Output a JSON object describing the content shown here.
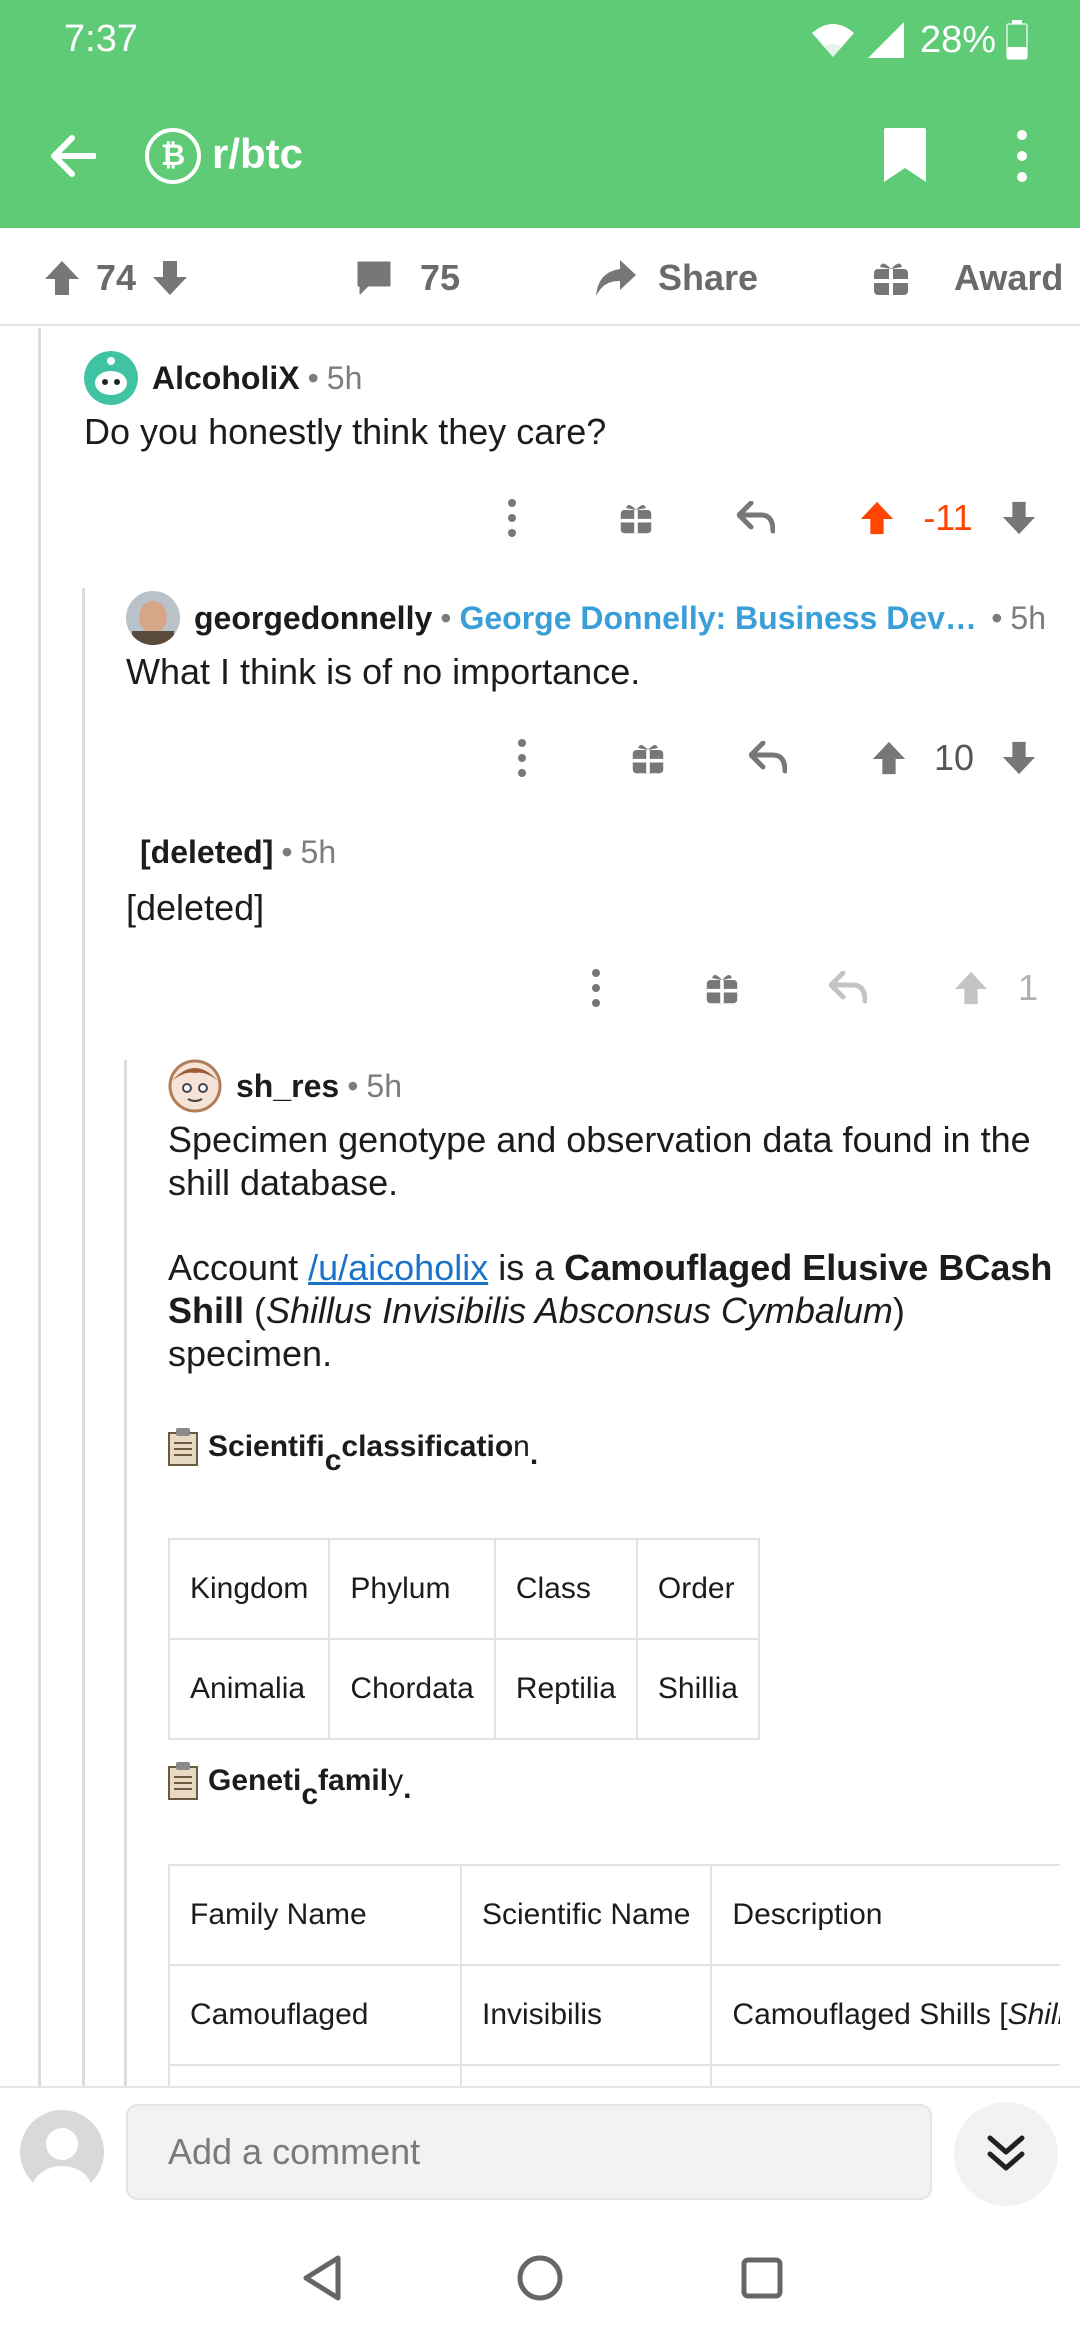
{
  "status": {
    "time": "7:37",
    "battery": "28%"
  },
  "header": {
    "subreddit": "r/btc",
    "sub_icon_glyph": "₿"
  },
  "post_bar": {
    "upvotes": "74",
    "comments": "75",
    "share": "Share",
    "award": "Award"
  },
  "comments": [
    {
      "user": "AlcoholiX",
      "time": "5h",
      "body": "Do you honestly think they care?",
      "score": "-11",
      "vote_state": "upvoted"
    },
    {
      "user": "georgedonnelly",
      "flair": "George Donnelly: Business Develop...",
      "time": "5h",
      "body": "What I think is of no importance.",
      "score": "10"
    },
    {
      "user": "[deleted]",
      "time": "5h",
      "body": "[deleted]",
      "score": "1"
    },
    {
      "user": "sh_res",
      "time": "5h",
      "para1": "Specimen genotype and observation data found in the shill database.",
      "para2": {
        "prefix": "Account ",
        "link": "/u/aicoholix",
        "mid": " is a ",
        "bold": "Camouflaged Elusive BCash Shill",
        "open": " (",
        "italic": "Shillus Invisibilis Absconsus Cymbalum",
        "close": ")",
        "tail": "specimen."
      },
      "sci": {
        "a": "Scientifi",
        "b": "c",
        "c": " classificatio",
        "d": "n",
        "e": "."
      },
      "classification": {
        "headers": [
          "Kingdom",
          "Phylum",
          "Class",
          "Order"
        ],
        "values": [
          "Animalia",
          "Chordata",
          "Reptilia",
          "Shillia"
        ]
      },
      "gen": {
        "a": "Geneti",
        "b": "c",
        "c": " famil",
        "d": "y",
        "e": "."
      },
      "family": {
        "headers": [
          "Family Name",
          "Scientific Name",
          "Description"
        ],
        "row": [
          "Camouflaged",
          "Invisibilis",
          "Camouflaged Shills [",
          "Shillu"
        ]
      }
    }
  ],
  "input": {
    "placeholder": "Add a comment"
  },
  "colors": {
    "header_green": "#5fcb77",
    "upvote_orange": "#ff4500",
    "flair_blue": "#3a9fd8",
    "link_blue": "#1a73c8"
  }
}
